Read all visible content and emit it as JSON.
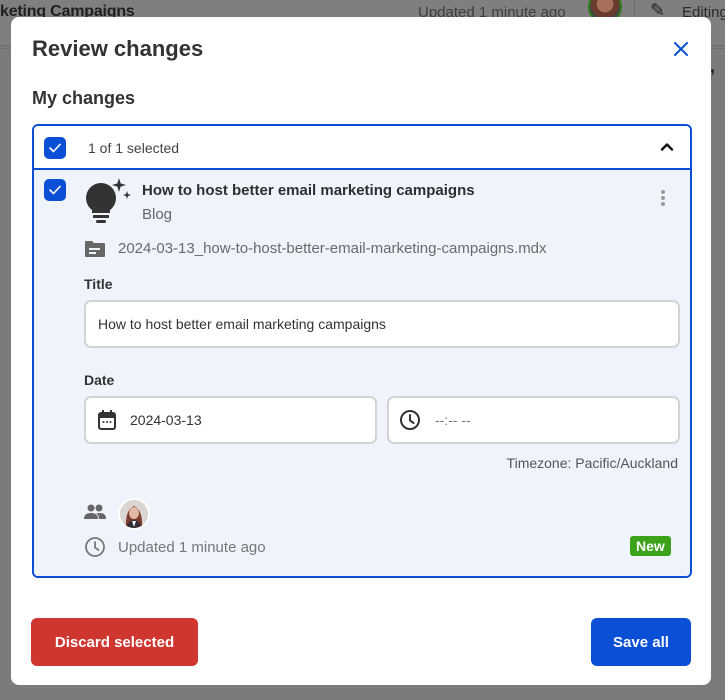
{
  "background": {
    "page_title": "keting Campaigns",
    "updated_text": "Updated 1 minute ago",
    "editing_label": "Editing"
  },
  "modal": {
    "title": "Review changes",
    "close_icon": "close-icon",
    "section_title": "My changes",
    "group": {
      "selected_count": "1 of 1 selected",
      "all_selected": true,
      "expanded": true,
      "items": [
        {
          "selected": true,
          "icon": "lightbulb-sparkle-icon",
          "title": "How to host better email marketing campaigns",
          "type": "Blog",
          "file_icon": "folder-icon",
          "file_name": "2024-03-13_how-to-host-better-email-marketing-campaigns.mdx",
          "fields": {
            "title_label": "Title",
            "title_value": "How to host better email marketing campaigns",
            "date_label": "Date",
            "date_value": "2024-03-13",
            "time_placeholder": "--:-- --",
            "timezone": "Timezone: Pacific/Auckland"
          },
          "updated": "Updated 1 minute ago",
          "badge": "New"
        }
      ]
    },
    "buttons": {
      "discard": "Discard selected",
      "save": "Save all"
    }
  },
  "colors": {
    "primary": "#0b4fd6",
    "danger": "#cf3630",
    "success": "#3ba21a",
    "panel_bg": "#eef3fc"
  }
}
